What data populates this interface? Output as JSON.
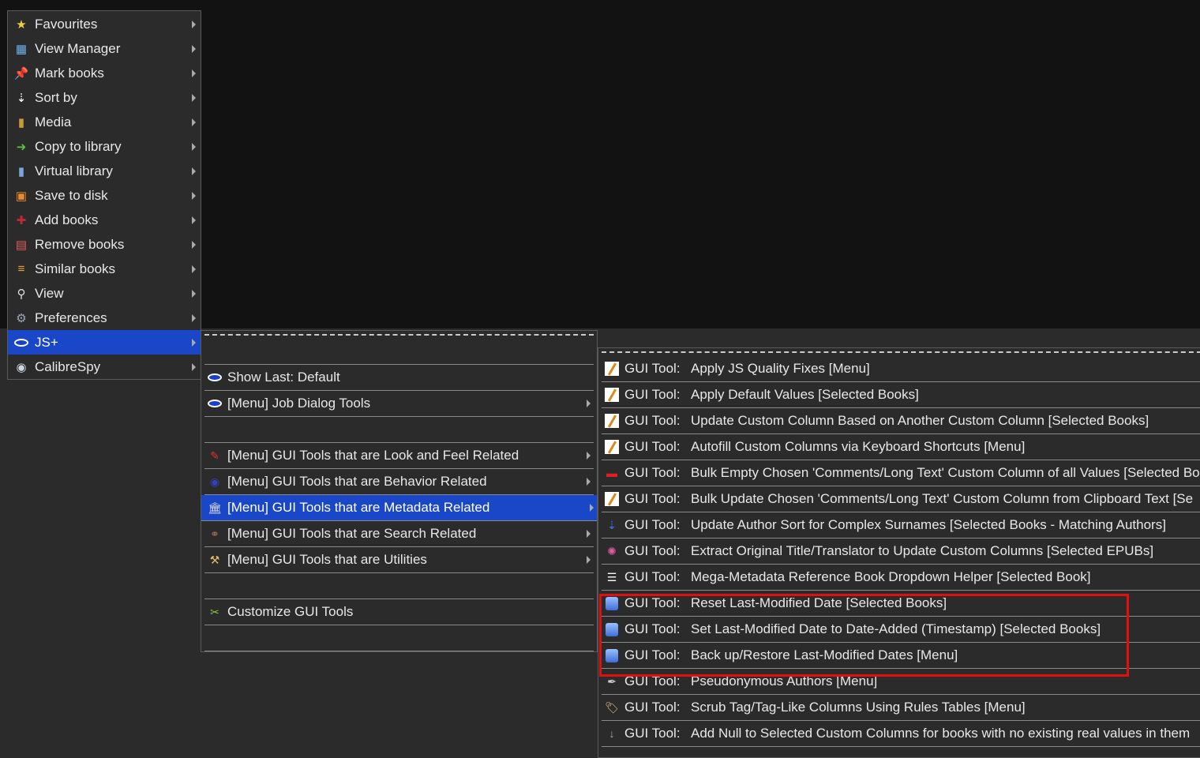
{
  "main_menu": {
    "items": [
      {
        "label": "Favourites",
        "icon": "star-icon",
        "glyph": "★",
        "color": "#f2d23a"
      },
      {
        "label": "View Manager",
        "icon": "view-manager-icon",
        "glyph": "▦",
        "color": "#6cb2e8"
      },
      {
        "label": "Mark books",
        "icon": "pushpin-icon",
        "glyph": "📌",
        "color": "#e23a2a"
      },
      {
        "label": "Sort by",
        "icon": "sort-icon",
        "glyph": "⇣",
        "color": "#ffffff"
      },
      {
        "label": "Media",
        "icon": "books-icon",
        "glyph": "▮",
        "color": "#c89a3a"
      },
      {
        "label": "Copy to library",
        "icon": "copy-library-icon",
        "glyph": "➜",
        "color": "#5cbf3a"
      },
      {
        "label": "Virtual library",
        "icon": "virtual-library-icon",
        "glyph": "▮",
        "color": "#7aa6d8"
      },
      {
        "label": "Save to disk",
        "icon": "floppy-icon",
        "glyph": "▣",
        "color": "#f08a2a"
      },
      {
        "label": "Add books",
        "icon": "add-book-icon",
        "glyph": "✚",
        "color": "#c0283a"
      },
      {
        "label": "Remove books",
        "icon": "trash-book-icon",
        "glyph": "▤",
        "color": "#e05a5a"
      },
      {
        "label": "Similar books",
        "icon": "similar-books-icon",
        "glyph": "≡",
        "color": "#f0a030"
      },
      {
        "label": "View",
        "icon": "magnifier-icon",
        "glyph": "⚲",
        "color": "#dddddd"
      },
      {
        "label": "Preferences",
        "icon": "gears-icon",
        "glyph": "⚙",
        "color": "#a0a8b8"
      },
      {
        "label": "JS+",
        "icon": "eye-icon",
        "glyph": "eye",
        "color": "#ffffff",
        "highlighted": true
      },
      {
        "label": "CalibreSpy",
        "icon": "calibrespy-eye-icon",
        "glyph": "◉",
        "color": "#cfd8e0"
      }
    ]
  },
  "submenu_jsplus": {
    "items": [
      {
        "empty": true
      },
      {
        "label": "Show Last: Default",
        "icon": "eye-icon",
        "glyph": "eye",
        "arrow": false
      },
      {
        "label": "[Menu] Job Dialog Tools",
        "icon": "eye-icon",
        "glyph": "eye",
        "arrow": true
      },
      {
        "empty": true
      },
      {
        "label": "[Menu] GUI Tools that are Look and Feel Related",
        "icon": "paintbrush-icon",
        "glyph": "✎",
        "color": "#e03030",
        "arrow": true
      },
      {
        "label": "[Menu] GUI Tools that are Behavior Related",
        "icon": "behavior-icon",
        "glyph": "◉",
        "color": "#3040c0",
        "arrow": true
      },
      {
        "label": "[Menu] GUI Tools that are Metadata Related",
        "icon": "pillar-icon",
        "glyph": "🏛",
        "color": "#dddddd",
        "arrow": true,
        "highlighted": true
      },
      {
        "label": "[Menu] GUI Tools that are Search Related",
        "icon": "binoculars-icon",
        "glyph": "⚭",
        "color": "#a07050",
        "arrow": true
      },
      {
        "label": "[Menu] GUI Tools that are Utilities",
        "icon": "tools-icon",
        "glyph": "⚒",
        "color": "#e0c060",
        "arrow": true
      },
      {
        "empty": true
      },
      {
        "label": "Customize GUI Tools",
        "icon": "customize-tools-icon",
        "glyph": "✂",
        "color": "#90c040",
        "arrow": false
      },
      {
        "empty": true
      }
    ]
  },
  "submenu_metadata": {
    "prefix": "GUI Tool:",
    "items": [
      {
        "label": "Apply JS Quality Fixes [Menu]",
        "icon": "pencil-icon",
        "glyph": "pencil"
      },
      {
        "label": "Apply Default Values [Selected Books]",
        "icon": "pencil-icon",
        "glyph": "pencil"
      },
      {
        "label": "Update Custom Column Based on Another Custom Column [Selected Books]",
        "icon": "pencil-icon",
        "glyph": "pencil"
      },
      {
        "label": "Autofill Custom Columns via Keyboard Shortcuts [Menu]",
        "icon": "pencil-icon",
        "glyph": "pencil"
      },
      {
        "label": "Bulk Empty Chosen 'Comments/Long Text' Custom Column of all Values [Selected Bo",
        "icon": "eraser-icon",
        "glyph": "▬",
        "color": "#e02020"
      },
      {
        "label": "Bulk Update Chosen 'Comments/Long Text' Custom Column from Clipboard Text [Se",
        "icon": "pencil-icon",
        "glyph": "pencil"
      },
      {
        "label": "Update Author Sort for Complex Surnames [Selected Books - Matching Authors]",
        "icon": "sort-down-icon",
        "glyph": "⇣",
        "color": "#3a7ae0"
      },
      {
        "label": "Extract Original Title/Translator to Update Custom Columns [Selected EPUBs]",
        "icon": "color-wheel-icon",
        "glyph": "✺",
        "color": "#e05aa0"
      },
      {
        "label": "Mega-Metadata Reference Book Dropdown Helper [Selected Book]",
        "icon": "list-dropdown-icon",
        "glyph": "☰",
        "color": "#ffffff"
      },
      {
        "label": "Reset Last-Modified Date [Selected Books]",
        "icon": "calendar-icon",
        "glyph": "cal"
      },
      {
        "label": "Set Last-Modified Date to Date-Added (Timestamp) [Selected Books]",
        "icon": "calendar-icon",
        "glyph": "cal"
      },
      {
        "label": "Back up/Restore Last-Modified Dates [Menu]",
        "icon": "calendar-icon",
        "glyph": "cal"
      },
      {
        "label": "Pseudonymous Authors [Menu]",
        "icon": "quill-icon",
        "glyph": "✒",
        "color": "#cccccc"
      },
      {
        "label": "Scrub Tag/Tag-Like Columns Using Rules Tables [Menu]",
        "icon": "tag-icon",
        "glyph": "🏷",
        "color": "#e0c090"
      },
      {
        "label": "Add Null to Selected Custom Columns for books with no existing real values in them",
        "icon": "null-icon",
        "glyph": "↓",
        "color": "#aaaaaa"
      }
    ]
  }
}
